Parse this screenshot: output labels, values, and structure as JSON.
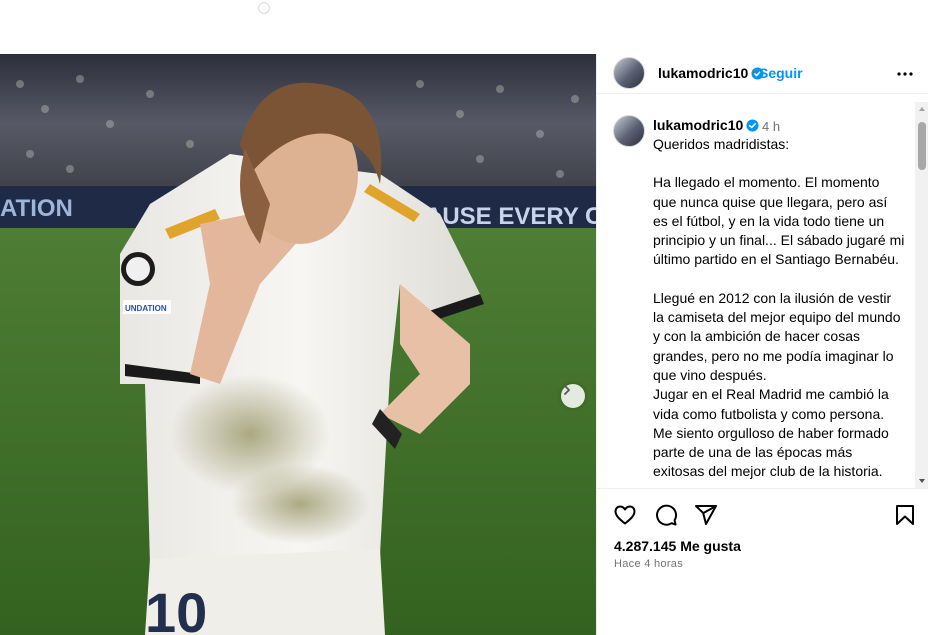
{
  "post": {
    "username": "lukamodric10",
    "follow_label": "Seguir",
    "separator": "•",
    "time_short": "4 h",
    "caption_paragraphs": [
      "Queridos madridistas:",
      "Ha llegado el momento. El momento que nunca quise que llegara, pero así es el fútbol, y en la vida todo tiene un principio y un final... El sábado jugaré mi último partido en el Santiago Bernabéu.",
      "Llegué en 2012 con la ilusión de vestir la camiseta del mejor equipo del mundo y con la ambición de hacer cosas grandes, pero no me podía imaginar lo que vino después.",
      "Jugar en el Real Madrid me cambió la vida como futbolista y como persona. Me siento orgulloso de haber formado parte de una de las épocas más exitosas del mejor club de la historia."
    ],
    "likes_count": "4.287.145",
    "likes_label": "Me gusta",
    "time_ago": "Hace 4 horas"
  },
  "media": {
    "jersey_number": "10",
    "banner_left": "ATION",
    "banner_right": "AUSE EVERY C",
    "sleeve_patch": "UNDATION"
  },
  "icons": {
    "verified": "verified-badge-icon",
    "more": "more-options-icon",
    "like": "heart-icon",
    "comment": "comment-icon",
    "share": "share-icon",
    "save": "bookmark-icon",
    "next": "chevron-right-icon"
  },
  "colors": {
    "accent": "#0095f6",
    "verified": "#0095f6",
    "muted": "#737373",
    "border": "#efefef"
  }
}
